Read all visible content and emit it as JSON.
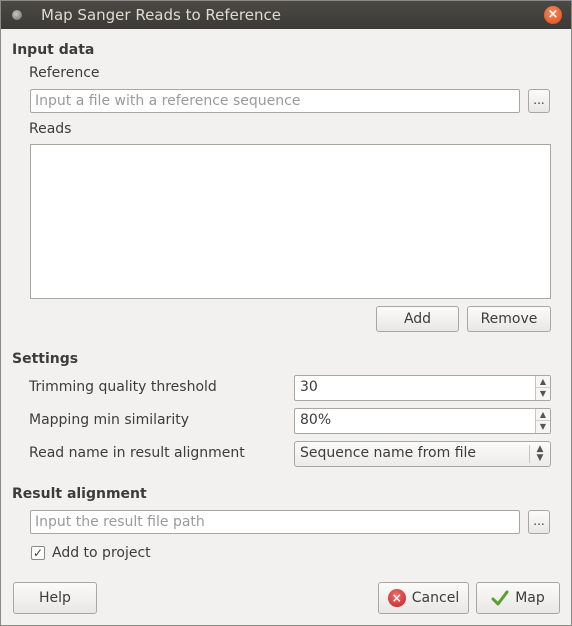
{
  "window": {
    "title": "Map Sanger Reads to Reference"
  },
  "input_data": {
    "section_label": "Input data",
    "reference_label": "Reference",
    "reference_placeholder": "Input a file with a reference sequence",
    "browse_label": "...",
    "reads_label": "Reads",
    "reads_items": [],
    "add_label": "Add",
    "remove_label": "Remove"
  },
  "settings": {
    "section_label": "Settings",
    "trimming_label": "Trimming quality threshold",
    "trimming_value": "30",
    "mapping_label": "Mapping min similarity",
    "mapping_value": "80%",
    "read_name_label": "Read name in result alignment",
    "read_name_value": "Sequence name from file"
  },
  "result": {
    "section_label": "Result alignment",
    "path_placeholder": "Input the result file path",
    "browse_label": "...",
    "add_to_project_label": "Add to project",
    "add_to_project_checked": true
  },
  "footer": {
    "help_label": "Help",
    "cancel_label": "Cancel",
    "map_label": "Map"
  },
  "icons": {
    "close": "close-icon",
    "cancel": "cancel-icon",
    "map": "check-icon",
    "window_menu": "window-menu-icon"
  }
}
